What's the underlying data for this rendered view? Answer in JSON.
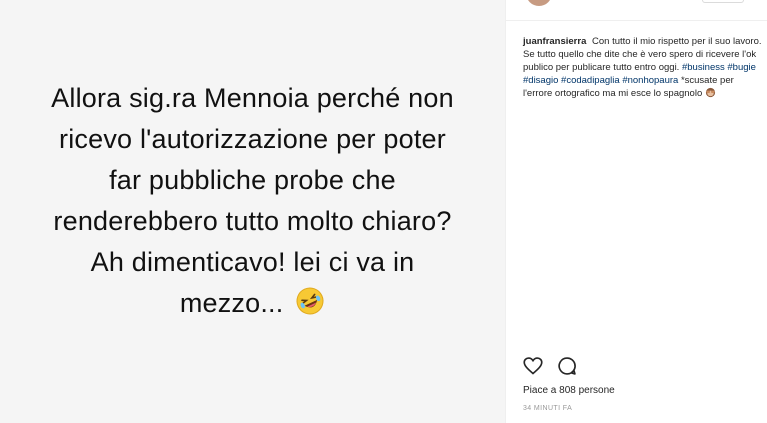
{
  "post": {
    "story_lines": [
      "Allora sig.ra Mennoia perché non",
      "ricevo l'autorizzazione per poter",
      "far pubbliche probe che",
      "renderebbero tutto molto chiaro?",
      "Ah dimenticavo! lei ci va in",
      "mezzo..."
    ],
    "emoji_icon": "rolling-on-floor-laughing-emoji"
  },
  "caption": {
    "username": "juanfransierra",
    "text_part1": "Con tutto il mio rispetto per il suo lavoro. Se tutto quello che dite che è vero spero di ricevere l'ok publico per publicare tutto entro oggi.",
    "hashtags": [
      "#business",
      "#bugie",
      "#disagio",
      "#codadipaglia",
      "#nonhopaura"
    ],
    "text_part2": "*scusate per l'errore ortografico ma mi esce lo spagnolo",
    "emoji_icon": "see-no-evil-monkey-emoji"
  },
  "actions": {
    "like_icon": "heart-icon",
    "comment_icon": "comment-icon"
  },
  "likes_text": "Piace a 808 persone",
  "timestamp": "34 MINUTI FA",
  "colors": {
    "hashtag": "#003569",
    "text": "#262626",
    "muted": "#999999",
    "image_bg": "#f5f5f5"
  }
}
